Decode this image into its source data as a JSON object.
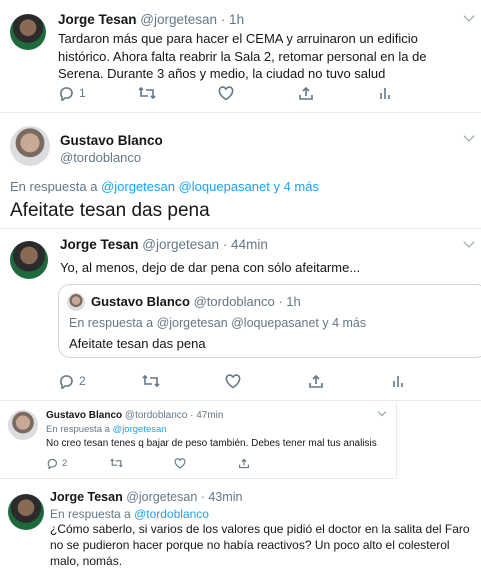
{
  "tweet1": {
    "name": "Jorge Tesan",
    "handle": "@jorgetesan",
    "time": "· 1h",
    "text": "Tardaron más que para hacer el CEMA y arruinaron un edificio histórico. Ahora falta reabrir la Sala 2, retomar personal en la de Serena. Durante 3 años y medio, la ciudad no tuvo salud",
    "replies": "1"
  },
  "tweet2": {
    "name": "Gustavo Blanco",
    "handle": "@tordoblanco",
    "reply_prefix": "En respuesta a",
    "reply_targets": "@jorgetesan @loquepasanet y 4 más",
    "text": "Afeitate tesan das pena"
  },
  "tweet3": {
    "name": "Jorge Tesan",
    "handle": "@jorgetesan",
    "time": "· 44min",
    "text": "Yo, al menos, dejo de dar pena con sólo afeitarme...",
    "quote": {
      "name": "Gustavo Blanco",
      "handle": "@tordoblanco",
      "time": "· 1h",
      "reply_prefix": "En respuesta a",
      "reply_targets": "@jorgetesan @loquepasanet y 4 más",
      "text": "Afeitate tesan das pena"
    },
    "replies": "2"
  },
  "tweet4": {
    "name": "Gustavo Blanco",
    "handle": "@tordoblanco",
    "time": "· 47min",
    "reply_prefix": "En respuesta a",
    "reply_targets": "@jorgetesan",
    "text": "No creo tesan tenes q bajar de peso también. Debes tener mal tus analisis",
    "replies": "2"
  },
  "tweet5": {
    "name": "Jorge Tesan",
    "handle": "@jorgetesan",
    "time": "· 43min",
    "reply_prefix": "En respuesta a",
    "reply_targets": "@tordoblanco",
    "text": "¿Cómo saberlo, si varios de los valores que pidió el doctor en la salita del Faro no se pudieron hacer porque no había reactivos? Un poco alto el colesterol malo, nomás."
  },
  "icons": [
    "reply-icon",
    "retweet-icon",
    "like-icon",
    "share-icon",
    "analytics-icon",
    "chevron-down-icon"
  ],
  "colors": {
    "link": "#1da1f2",
    "muted": "#657786",
    "text": "#14171a",
    "divider": "#e6ecf0"
  }
}
